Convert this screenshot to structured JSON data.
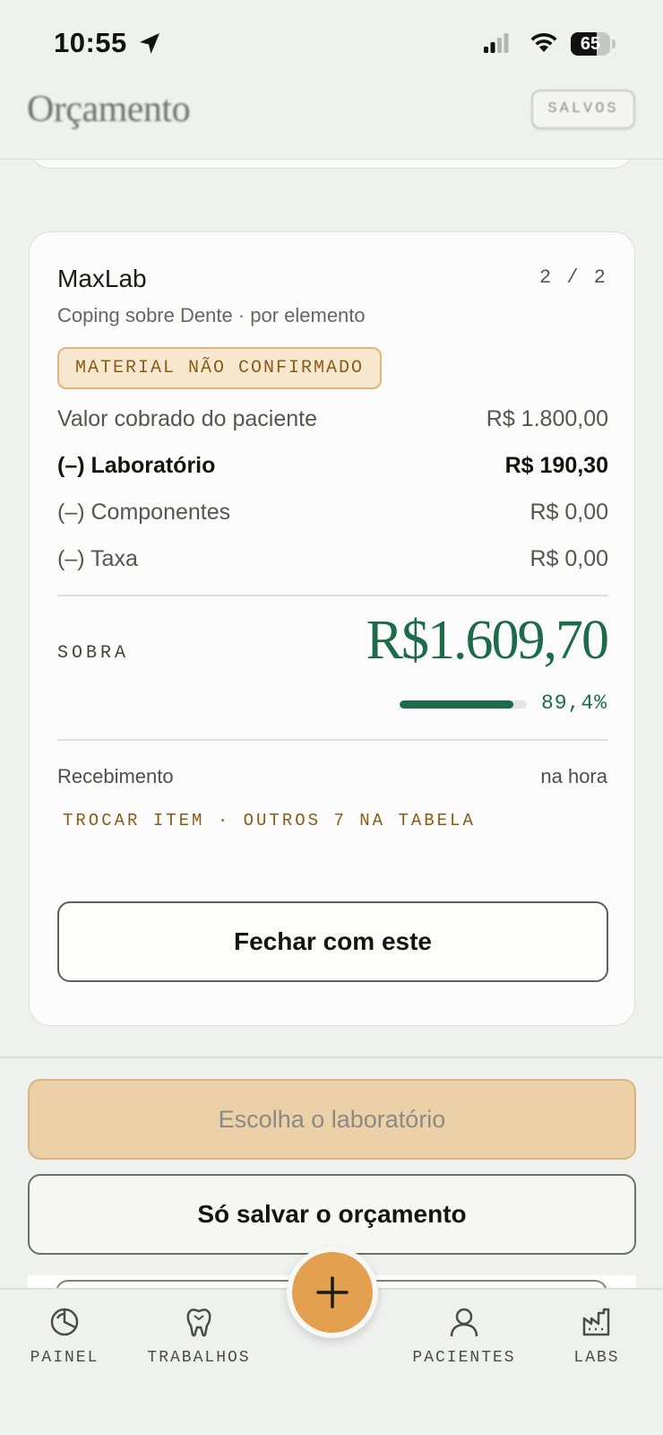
{
  "status_bar": {
    "time": "10:55",
    "battery": "65",
    "battery_level": 0.65
  },
  "header": {
    "title": "Orçamento",
    "saved_label": "SALVOS"
  },
  "card": {
    "lab_name": "MaxLab",
    "counter": "2 / 2",
    "subtitle": "Coping sobre Dente · por elemento",
    "badge": "MATERIAL NÃO CONFIRMADO",
    "rows": [
      {
        "label": "Valor cobrado do paciente",
        "value": "R$ 1.800,00"
      },
      {
        "label": "(–) Laboratório",
        "value": "R$ 190,30"
      },
      {
        "label": "(–) Componentes",
        "value": "R$ 0,00"
      },
      {
        "label": "(–) Taxa",
        "value": "R$ 0,00"
      }
    ],
    "sobra_label": "SOBRA",
    "sobra_value": "R$1.609,70",
    "margin_fraction": 0.894,
    "margin_pct": "89,4%",
    "receb_label": "Recebimento",
    "receb_value": "na hora",
    "swap_link": "TROCAR ITEM · OUTROS 7 NA TABELA",
    "close_button": "Fechar com este"
  },
  "actions": {
    "choose_lab": "Escolha o laboratório",
    "save_only": "Só salvar o orçamento"
  },
  "tabs": [
    {
      "label": "PAINEL",
      "icon": "dashboard-icon"
    },
    {
      "label": "TRABALHOS",
      "icon": "tooth-icon"
    },
    {
      "label": "PACIENTES",
      "icon": "person-icon"
    },
    {
      "label": "LABS",
      "icon": "factory-icon"
    }
  ],
  "colors": {
    "accent_green": "#1d6b4a",
    "accent_orange": "#e3a04f",
    "warning_brown": "#8a5b15"
  }
}
